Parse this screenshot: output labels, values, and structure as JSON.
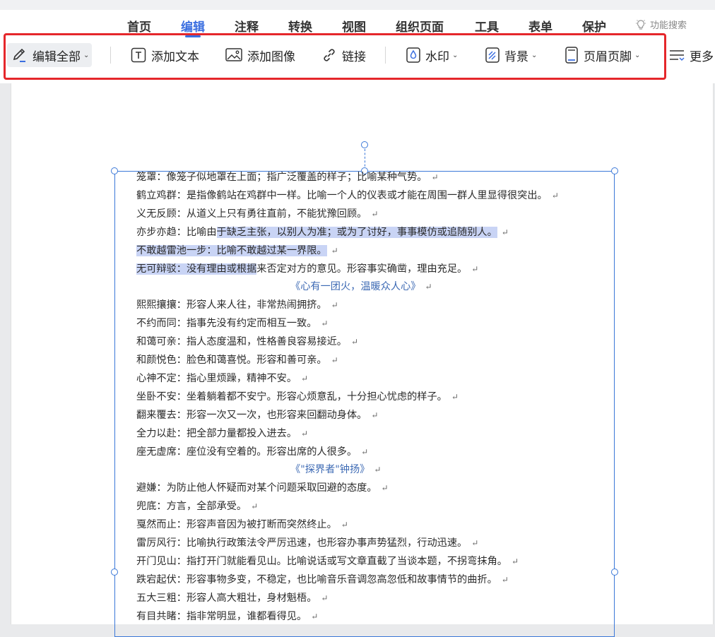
{
  "menu": {
    "items": [
      "首页",
      "编辑",
      "注释",
      "转换",
      "视图",
      "组织页面",
      "工具",
      "表单",
      "保护"
    ],
    "active": "编辑",
    "search_label": "功能搜索"
  },
  "toolbar": {
    "edit_all": "编辑全部",
    "add_text": "添加文本",
    "add_image": "添加图像",
    "link": "链接",
    "watermark": "水印",
    "background": "背景",
    "header_footer": "页眉页脚",
    "more": "更多"
  },
  "document": {
    "lines": [
      {
        "text": "笼罩：像笼子似地罩在上面；指广泛覆盖的样子；比喻某种气势。"
      },
      {
        "text": "鹤立鸡群：是指像鹤站在鸡群中一样。比喻一个人的仪表或才能在周围一群人里显得很突出。"
      },
      {
        "text": "义无反顾：从道义上只有勇往直前，不能犹豫回顾。"
      },
      {
        "pre": "亦步亦趋：比喻由",
        "sel": "于缺乏主张，以别人为准；或为了讨好，事事模仿或追随别人。",
        "post": ""
      },
      {
        "pre": "",
        "sel": "不敢越雷池一步：比喻不敢越过某一界限。",
        "post": ""
      },
      {
        "pre": "",
        "sel": "无可辩驳：没有理由或根据",
        "post": "来否定对方的意见。形容事实确凿，理由充足。"
      },
      {
        "text": "《心有一团火，温暖众人心》",
        "center": true
      },
      {
        "text": "熙熙攘攘：形容人来人往，非常热闹拥挤。"
      },
      {
        "text": "不约而同：指事先没有约定而相互一致。"
      },
      {
        "text": "和蔼可亲：指人态度温和，性格善良容易接近。"
      },
      {
        "text": "和颜悦色：脸色和蔼喜悦。形容和善可亲。"
      },
      {
        "text": "心神不定：指心里烦躁，精神不安。"
      },
      {
        "text": "坐卧不安：坐着躺着都不安宁。形容心烦意乱，十分担心忧虑的样子。"
      },
      {
        "text": "翻来覆去：形容一次又一次，也形容来回翻动身体。"
      },
      {
        "text": "全力以赴：把全部力量都投入进去。"
      },
      {
        "text": "座无虚席：座位没有空着的。形容出席的人很多。"
      },
      {
        "text": "《\"探界者\"钟扬》",
        "center": true
      },
      {
        "text": "避嫌：为防止他人怀疑而对某个问题采取回避的态度。"
      },
      {
        "text": "兜底：方言，全部承受。"
      },
      {
        "text": "戛然而止：形容声音因为被打断而突然终止。"
      },
      {
        "text": "雷厉风行：比喻执行政策法令严厉迅速，也形容办事声势猛烈，行动迅速。"
      },
      {
        "text": "开门见山：指打开门就能看见山。比喻说话或写文章直截了当谈本题，不拐弯抹角。"
      },
      {
        "text": "跌宕起伏：形容事物多变，不稳定，也比喻音乐音调忽高忽低和故事情节的曲折。"
      },
      {
        "text": "五大三粗：形容人高大粗壮，身材魁梧。"
      },
      {
        "text": "有目共睹：指非常明显，谁都看得见。"
      }
    ],
    "paragraph_mark": "↵"
  }
}
